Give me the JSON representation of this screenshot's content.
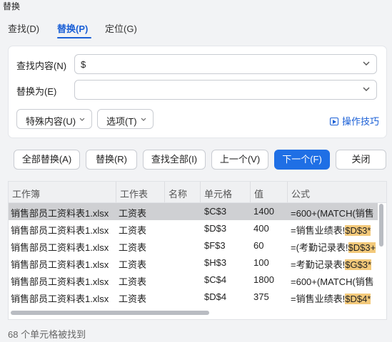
{
  "window": {
    "title": "替换"
  },
  "tabs": [
    {
      "label": "查找(D)",
      "active": false
    },
    {
      "label": "替换(P)",
      "active": true
    },
    {
      "label": "定位(G)",
      "active": false
    }
  ],
  "find": {
    "label": "查找内容(N)",
    "value": "$"
  },
  "replace": {
    "label": "替换为(E)",
    "value": ""
  },
  "dropdowns": {
    "special": "特殊内容(U)",
    "options": "选项(T)"
  },
  "tips": "操作技巧",
  "buttons": {
    "replace_all": "全部替换(A)",
    "replace": "替换(R)",
    "find_all": "查找全部(I)",
    "prev": "上一个(V)",
    "next": "下一个(F)",
    "close": "关闭"
  },
  "table": {
    "headers": [
      "工作簿",
      "工作表",
      "名称",
      "单元格",
      "值",
      "公式"
    ],
    "rows": [
      {
        "workbook": "销售部员工资料表1.xlsx",
        "sheet": "工资表",
        "name": "",
        "cell": "$C$3",
        "value": "1400",
        "formula_pre": "=600+(MATCH(销售",
        "formula_hl": ""
      },
      {
        "workbook": "销售部员工资料表1.xlsx",
        "sheet": "工资表",
        "name": "",
        "cell": "$D$3",
        "value": "400",
        "formula_pre": "=销售业绩表!",
        "formula_hl": "$D$3*"
      },
      {
        "workbook": "销售部员工资料表1.xlsx",
        "sheet": "工资表",
        "name": "",
        "cell": "$F$3",
        "value": "60",
        "formula_pre": "=(考勤记录表!",
        "formula_hl": "$D$3+"
      },
      {
        "workbook": "销售部员工资料表1.xlsx",
        "sheet": "工资表",
        "name": "",
        "cell": "$H$3",
        "value": "100",
        "formula_pre": "=考勤记录表!",
        "formula_hl": "$G$3*"
      },
      {
        "workbook": "销售部员工资料表1.xlsx",
        "sheet": "工资表",
        "name": "",
        "cell": "$C$4",
        "value": "1800",
        "formula_pre": "=600+(MATCH(销售",
        "formula_hl": ""
      },
      {
        "workbook": "销售部员工资料表1.xlsx",
        "sheet": "工资表",
        "name": "",
        "cell": "$D$4",
        "value": "375",
        "formula_pre": "=销售业绩表!",
        "formula_hl": "$D$4*"
      }
    ]
  },
  "status": "68 个单元格被找到",
  "colors": {
    "accent": "#1f6fe5",
    "highlight": "#f3c97a",
    "selected_row": "#cfd0d3"
  }
}
